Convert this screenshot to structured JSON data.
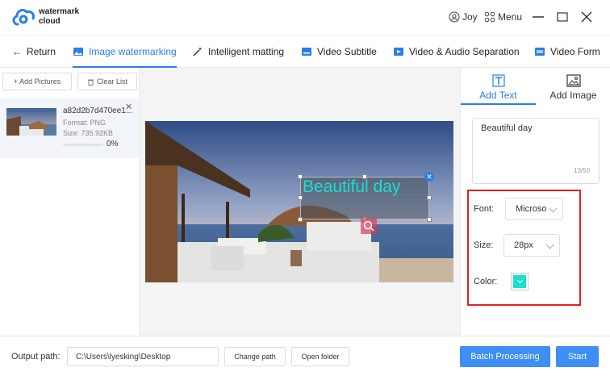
{
  "app": {
    "brand_line1": "watermark",
    "brand_line2": "cloud",
    "user": "Joy",
    "menu": "Menu"
  },
  "nav": {
    "return": "Return",
    "tabs": [
      {
        "label": "Image watermarking",
        "icon": "image-icon",
        "active": true
      },
      {
        "label": "Intelligent matting",
        "icon": "magic-wand-icon"
      },
      {
        "label": "Video Subtitle",
        "icon": "video-subtitle-icon"
      },
      {
        "label": "Video & Audio Separation",
        "icon": "video-audio-icon"
      },
      {
        "label": "Video Form",
        "icon": "video-format-icon"
      }
    ]
  },
  "left": {
    "add_pictures": "+ Add Pictures",
    "clear_list": "Clear List",
    "file": {
      "name": "a82d2b7d470ee1...",
      "format": "Format:  PNG",
      "size": "Size:  735.92KB",
      "progress": "0%",
      "progress_value": 0
    }
  },
  "canvas": {
    "watermark_text": "Beautiful day"
  },
  "right": {
    "tabs": {
      "add_text": "Add Text",
      "add_image": "Add Image"
    },
    "text_value": "Beautiful day",
    "char_count": "13/50",
    "font_label": "Font:",
    "font_value": "Microso",
    "size_label": "Size:",
    "size_value": "28px",
    "color_label": "Color:",
    "color_value": "#18e0d0"
  },
  "footer": {
    "output_label": "Output path:",
    "output_path": "C:\\Users\\lyesking\\Desktop",
    "change_path": "Change path",
    "open_folder": "Open folder",
    "batch": "Batch Processing",
    "start": "Start"
  },
  "colors": {
    "accent": "#2a7ee8",
    "primary_button": "#3d8ef5",
    "highlight_border": "#e02020",
    "watermark": "#18e0d0"
  }
}
